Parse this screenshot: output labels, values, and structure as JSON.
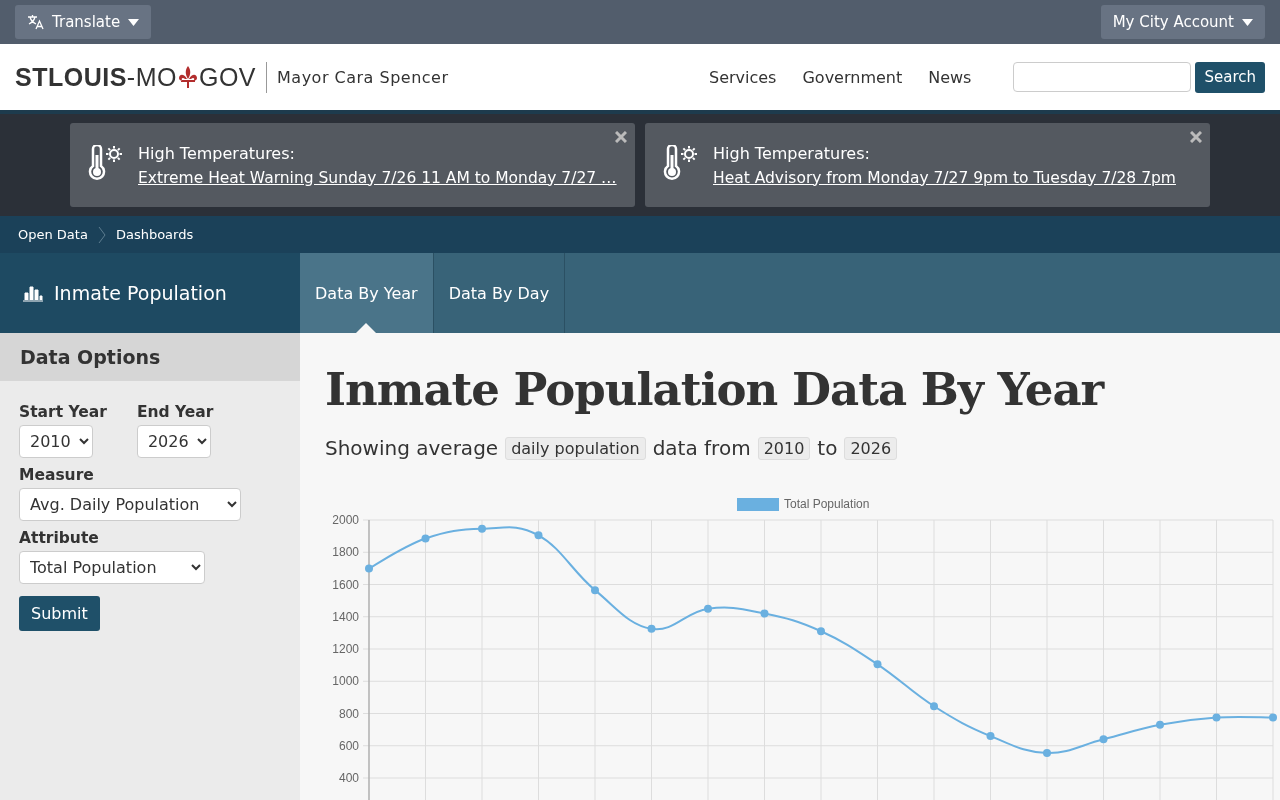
{
  "topbar": {
    "translate": "Translate",
    "account": "My City Account"
  },
  "header": {
    "logo": {
      "bold": "STLOUIS",
      "rest_left": "-MO",
      "rest_right": "GOV"
    },
    "tagline": "Mayor Cara Spencer",
    "nav": [
      "Services",
      "Government",
      "News"
    ],
    "search": {
      "button": "Search"
    }
  },
  "alerts": [
    {
      "title": "High Temperatures:",
      "link": "Extreme Heat Warning Sunday 7/26 11 AM to Monday 7/27 …"
    },
    {
      "title": "High Temperatures:",
      "link": "Heat Advisory from Monday 7/27 9pm to Tuesday 7/28 7pm"
    }
  ],
  "breadcrumb": [
    "Open Data",
    "Dashboards"
  ],
  "dashboard": {
    "title": "Inmate Population",
    "tabs": [
      {
        "label": "Data By Year",
        "selected": true
      },
      {
        "label": "Data By Day",
        "selected": false
      }
    ]
  },
  "sidebar": {
    "heading": "Data Options",
    "start_year": {
      "label": "Start Year",
      "value": "2010"
    },
    "end_year": {
      "label": "End Year",
      "value": "2026"
    },
    "measure": {
      "label": "Measure",
      "value": "Avg. Daily Population"
    },
    "attribute": {
      "label": "Attribute",
      "value": "Total Population"
    },
    "submit": "Submit"
  },
  "main": {
    "heading": "Inmate Population Data By Year",
    "summary": {
      "prefix": "Showing average",
      "measure": "daily population",
      "middle": "data from",
      "start": "2010",
      "joiner": "to",
      "end": "2026"
    },
    "chart_data": {
      "type": "line",
      "grid": true,
      "ylim": [
        400,
        2000
      ],
      "yticks": [
        400,
        600,
        800,
        1000,
        1200,
        1400,
        1600,
        1800,
        2000
      ],
      "series": [
        {
          "name": "Total Population",
          "color": "#6ab0e0",
          "marker": true,
          "values": [
            1700,
            1885,
            1945,
            1905,
            1565,
            1325,
            1450,
            1420,
            1310,
            1105,
            845,
            660,
            555,
            640,
            730,
            775,
            775
          ]
        }
      ]
    }
  }
}
